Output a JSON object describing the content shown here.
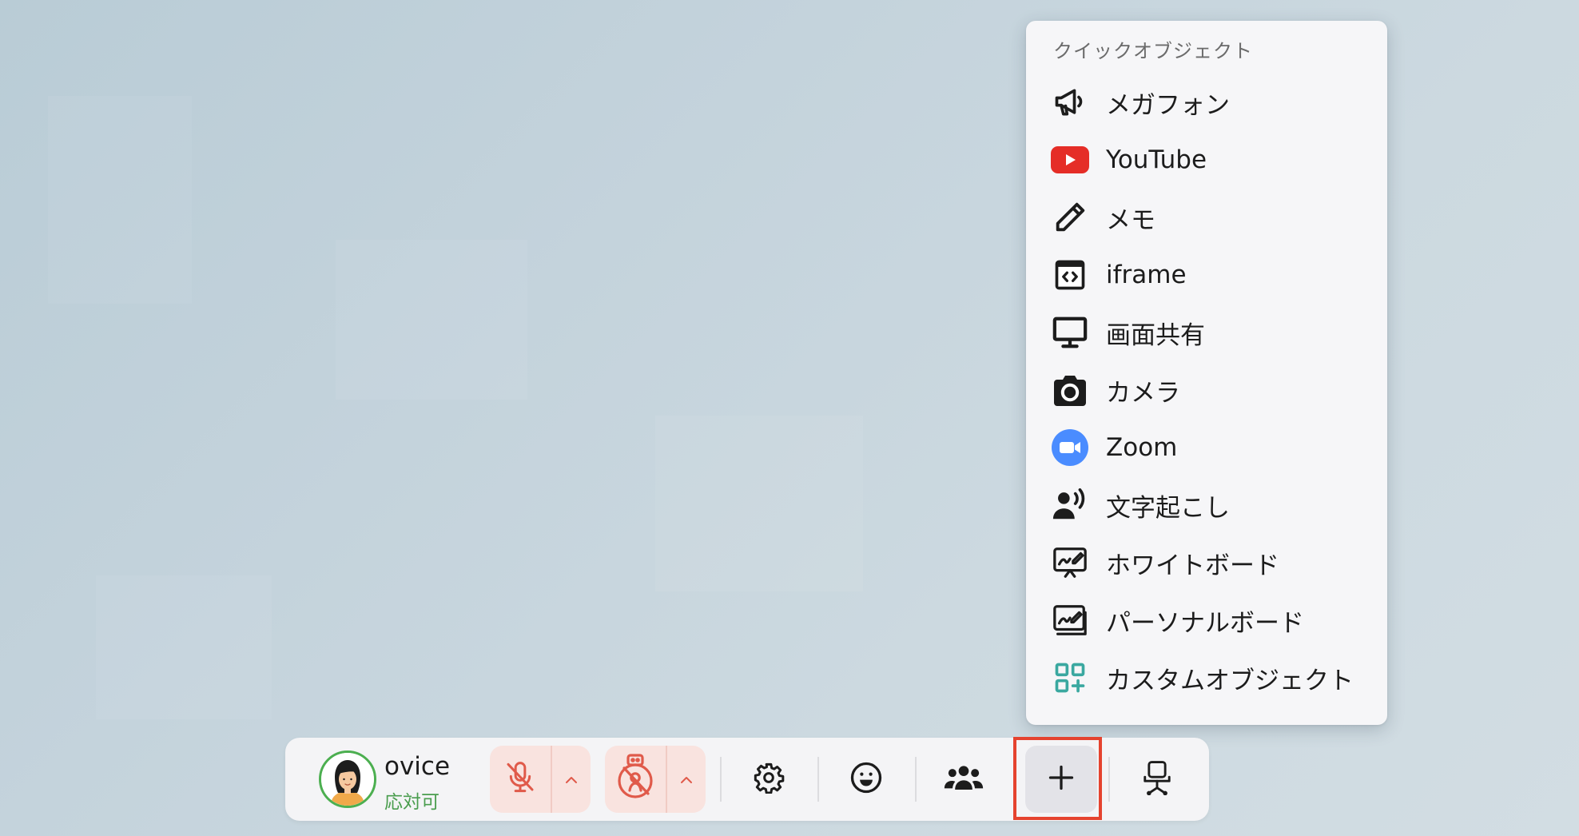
{
  "quick_objects": {
    "header": "クイックオブジェクト",
    "items": [
      {
        "label": "メガフォン",
        "icon": "megaphone-icon"
      },
      {
        "label": "YouTube",
        "icon": "youtube-icon"
      },
      {
        "label": "メモ",
        "icon": "pencil-icon"
      },
      {
        "label": "iframe",
        "icon": "iframe-icon"
      },
      {
        "label": "画面共有",
        "icon": "monitor-icon"
      },
      {
        "label": "カメラ",
        "icon": "camera-icon"
      },
      {
        "label": "Zoom",
        "icon": "zoom-icon"
      },
      {
        "label": "文字起こし",
        "icon": "transcription-icon"
      },
      {
        "label": "ホワイトボード",
        "icon": "whiteboard-icon"
      },
      {
        "label": "パーソナルボード",
        "icon": "personal-board-icon"
      },
      {
        "label": "カスタムオブジェクト",
        "icon": "custom-object-icon"
      }
    ]
  },
  "toolbar": {
    "user_name": "ovice",
    "user_status": "応対可",
    "buttons": {
      "mic": "mic-off-icon",
      "camera": "camera-off-icon",
      "settings": "gear-icon",
      "reaction": "smiley-icon",
      "members": "group-icon",
      "add": "plus-icon",
      "seat": "chair-icon"
    }
  },
  "colors": {
    "youtube": "#e52d27",
    "zoom": "#4a8cff",
    "custom": "#3aa8a0",
    "status_available": "#4a9d4e",
    "muted": "#e05a4a",
    "highlight": "#e5432f"
  }
}
